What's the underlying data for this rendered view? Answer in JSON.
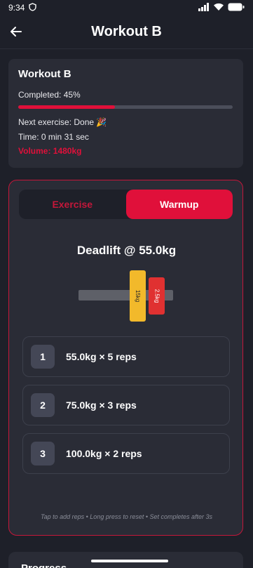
{
  "status_bar": {
    "time": "9:34"
  },
  "app_bar": {
    "title": "Workout B"
  },
  "summary": {
    "workout_name": "Workout B",
    "completed_label": "Completed: 45%",
    "completed_fraction": 0.45,
    "next_exercise": "Next exercise: Done 🎉",
    "time": "Time: 0 min 31 sec",
    "volume": "Volume: 1480kg"
  },
  "tabs": [
    {
      "label": "Exercise",
      "active": false
    },
    {
      "label": "Warmup",
      "active": true
    }
  ],
  "exercise": {
    "title": "Deadlift @ 55.0kg",
    "plates": [
      {
        "label": "15kg",
        "color": "#f2b92b"
      },
      {
        "label": "2.5kg",
        "color": "#e03131"
      }
    ]
  },
  "sets": [
    {
      "number": "1",
      "text": "55.0kg × 5 reps"
    },
    {
      "number": "2",
      "text": "75.0kg × 3 reps"
    },
    {
      "number": "3",
      "text": "100.0kg × 2 reps"
    }
  ],
  "hint": "Tap to add reps • Long press to reset • Set completes after 3s",
  "progress_section": {
    "title": "Progress"
  },
  "colors": {
    "accent": "#e0103a",
    "background": "#1e2029",
    "card": "#2a2c36"
  }
}
